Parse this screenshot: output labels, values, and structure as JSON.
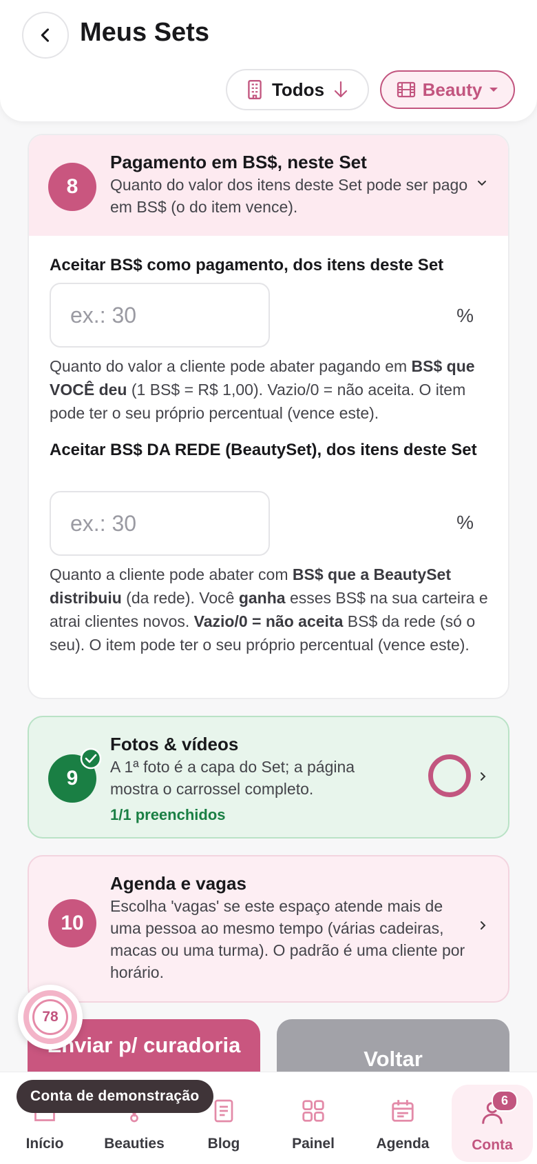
{
  "header": {
    "title": "Meus Sets",
    "filter_todos": "Todos",
    "filter_beauty": "Beauty"
  },
  "section8": {
    "number": "8",
    "title": "Pagamento em BS$, neste Set",
    "description": "Quanto do valor dos itens deste Set pode ser pago em BS$ (o do item vence).",
    "field1": {
      "label": "Aceitar BS$ como pagamento, dos itens deste Set",
      "placeholder": "ex.: 30",
      "unit": "%",
      "help_1": "Quanto do valor a cliente pode abater pagando em ",
      "help_b1": "BS$ que VOCÊ deu",
      "help_2": " (1 BS$ = R$ 1,00). Vazio/0 = não aceita. O item pode ter o seu próprio percentual (vence este)."
    },
    "field2": {
      "label": "Aceitar BS$ DA REDE (BeautySet), dos itens deste Set",
      "placeholder": "ex.: 30",
      "unit": "%",
      "help_1": "Quanto a cliente pode abater com ",
      "help_b1": "BS$ que a BeautySet distribuiu",
      "help_2": " (da rede). Você ",
      "help_b2": "ganha",
      "help_3": " esses BS$ na sua carteira e atrai clientes novos. ",
      "help_b3": "Vazio/0 = não aceita",
      "help_4": " BS$ da rede (só o seu). O item pode ter o seu próprio percentual (vence este)."
    }
  },
  "section9": {
    "number": "9",
    "title": "Fotos & vídeos",
    "description": "A 1ª foto é a capa do Set; a página mostra o carrossel completo.",
    "status": "1/1 preenchidos"
  },
  "section10": {
    "number": "10",
    "title": "Agenda e vagas",
    "description": "Escolha 'vagas' se este espaço atende mais de uma pessoa ao mesmo tempo (várias cadeiras, macas ou uma turma). O padrão é uma cliente por horário."
  },
  "score": "78",
  "actions": {
    "send": "Enviar p/ curadoria",
    "back": "Voltar"
  },
  "toast": "Conta de demonstração",
  "nav": {
    "inicio": "Início",
    "beauties": "Beauties",
    "blog": "Blog",
    "painel": "Painel",
    "agenda": "Agenda",
    "conta": "Conta",
    "conta_badge": "6"
  },
  "colors": {
    "accent": "#c2557f",
    "success": "#1a7f44",
    "card_pink": "#fdeaf0",
    "card_green": "#e8f5ec"
  }
}
